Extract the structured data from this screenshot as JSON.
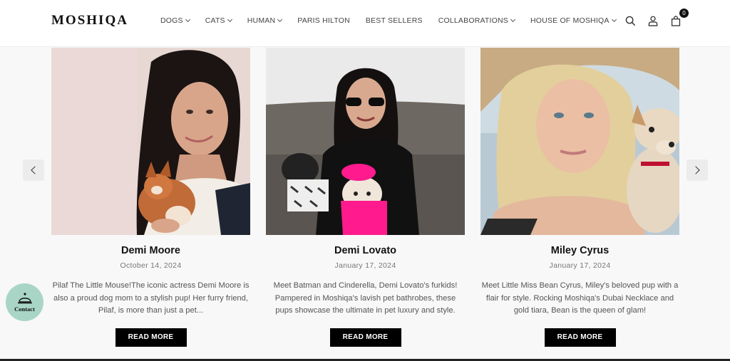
{
  "header": {
    "logo": "MOSHIQA",
    "nav": [
      {
        "label": "DOGS",
        "dropdown": true
      },
      {
        "label": "CATS",
        "dropdown": true
      },
      {
        "label": "HUMAN",
        "dropdown": true
      },
      {
        "label": "PARIS HILTON",
        "dropdown": false
      },
      {
        "label": "BEST SELLERS",
        "dropdown": false
      },
      {
        "label": "COLLABORATIONS",
        "dropdown": true
      },
      {
        "label": "HOUSE OF MOSHIQA",
        "dropdown": true
      }
    ],
    "icons": [
      "search-icon",
      "account-icon",
      "cart-icon"
    ],
    "cart_count": "0"
  },
  "posts": [
    {
      "name": "Demi Moore",
      "date": "October 14, 2024",
      "excerpt": "Pilaf The Little Mouse!The iconic actress Demi Moore is also a proud dog mom to a stylish pup! Her furry friend, Pilaf, is more than just a pet...",
      "button": "READ MORE"
    },
    {
      "name": "Demi Lovato",
      "date": "January 17, 2024",
      "excerpt": "Meet Batman and Cinderella, Demi Lovato's furkids! Pampered in Moshiqa's lavish pet bathrobes, these pups showcase the ultimate in pet luxury and style.",
      "button": "READ MORE"
    },
    {
      "name": "Miley Cyrus",
      "date": "January 17, 2024",
      "excerpt": "Meet Little Miss Bean Cyrus, Miley's beloved pup with a flair for style. Rocking Moshiqa's Dubai Necklace and gold tiara, Bean is the queen of glam!",
      "button": "READ MORE"
    }
  ],
  "contact": {
    "label": "Contact"
  },
  "colors": {
    "accent": "#000000",
    "contact_bg": "#a9d5c7"
  }
}
